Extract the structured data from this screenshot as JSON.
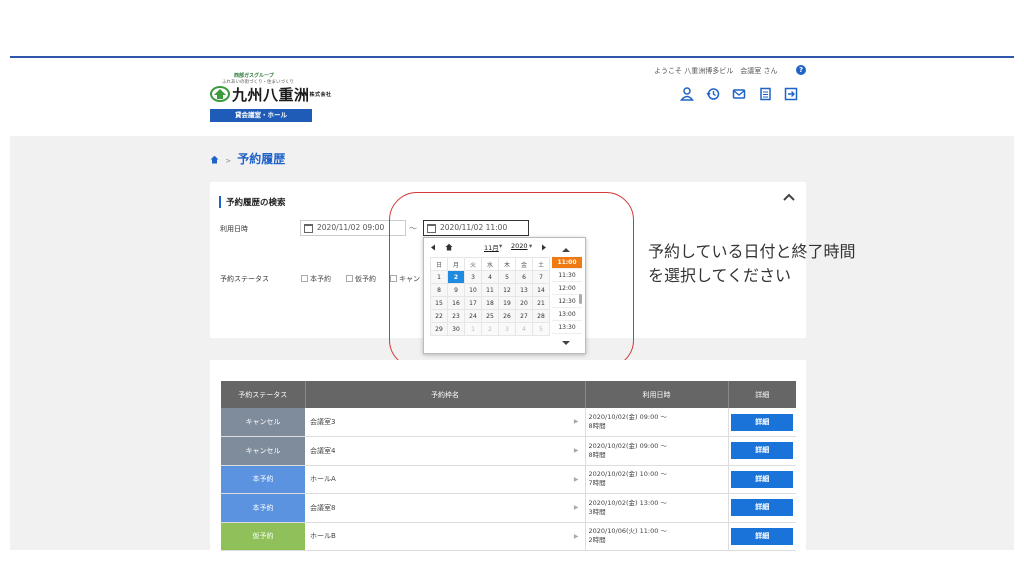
{
  "header": {
    "logo_group": "西部ガスグループ",
    "logo_tagline": "ふれあいの街づくり・住まいづくり",
    "logo_name": "九州八重洲",
    "logo_name_suffix": "株式会社",
    "logo_sub": "貸会議室・ホール",
    "welcome": "ようこそ 八重洲博多ビル　会議室 さん",
    "help": "?",
    "icons": [
      "user-icon",
      "history-icon",
      "mail-icon",
      "document-icon",
      "logout-icon"
    ]
  },
  "breadcrumb": {
    "separator": ">",
    "title": "予約履歴"
  },
  "search": {
    "title": "予約履歴の検索",
    "date_label": "利用日時",
    "date_from": "2020/11/02 09:00",
    "tilde": "～",
    "date_to": "2020/11/02 11:00",
    "status_label": "予約ステータス",
    "status_options": [
      "本予約",
      "仮予約",
      "キャン"
    ]
  },
  "picker": {
    "month": "11月",
    "year": "2020",
    "weekdays": [
      "日",
      "月",
      "火",
      "水",
      "木",
      "金",
      "土"
    ],
    "weeks": [
      [
        "1",
        "2",
        "3",
        "4",
        "5",
        "6",
        "7"
      ],
      [
        "8",
        "9",
        "10",
        "11",
        "12",
        "13",
        "14"
      ],
      [
        "15",
        "16",
        "17",
        "18",
        "19",
        "20",
        "21"
      ],
      [
        "22",
        "23",
        "24",
        "25",
        "26",
        "27",
        "28"
      ],
      [
        "29",
        "30",
        "1",
        "2",
        "3",
        "4",
        "5"
      ]
    ],
    "selected_day": "2",
    "times": [
      "11:00",
      "11:30",
      "12:00",
      "12:30",
      "13:00",
      "13:30"
    ],
    "selected_time": "11:00"
  },
  "callout": {
    "line1": "予約している日付と終了時間",
    "line2": "を選択してください"
  },
  "colors": {
    "accent": "#1f63c7",
    "cancel": "#7f8c9c",
    "confirmed": "#5b93e0",
    "tentative": "#8fc05a",
    "ring": "#d23a3a"
  },
  "table": {
    "headers": [
      "予約ステータス",
      "予約枠名",
      "利用日時",
      "詳細"
    ],
    "rows": [
      {
        "status": "キャンセル",
        "kind": "cancel",
        "name": "会議室3",
        "date": "2020/10/02(金) 09:00 ～",
        "duration": "8時間",
        "detail": "詳細"
      },
      {
        "status": "キャンセル",
        "kind": "cancel",
        "name": "会議室4",
        "date": "2020/10/02(金) 09:00 ～",
        "duration": "8時間",
        "detail": "詳細"
      },
      {
        "status": "本予約",
        "kind": "confirmed",
        "name": "ホールA",
        "date": "2020/10/02(金) 10:00 ～",
        "duration": "7時間",
        "detail": "詳細"
      },
      {
        "status": "本予約",
        "kind": "confirmed",
        "name": "会議室8",
        "date": "2020/10/02(金) 13:00 ～",
        "duration": "3時間",
        "detail": "詳細"
      },
      {
        "status": "仮予約",
        "kind": "tentative",
        "name": "ホールB",
        "date": "2020/10/06(火) 11:00 ～",
        "duration": "2時間",
        "detail": "詳細"
      }
    ]
  }
}
